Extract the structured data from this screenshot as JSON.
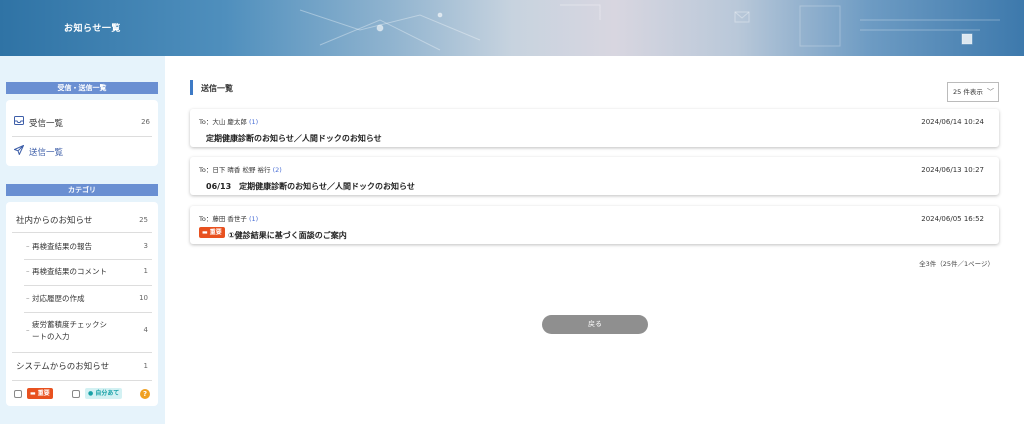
{
  "header": {
    "title": "お知らせ一覧"
  },
  "sidebar": {
    "mailbox_heading": "受信・送信一覧",
    "inbox": {
      "label": "受信一覧",
      "count": "26"
    },
    "sent": {
      "label": "送信一覧"
    },
    "category_heading": "カテゴリ",
    "categories": [
      {
        "label": "社内からのお知らせ",
        "count": "25"
      },
      {
        "label": "システムからのお知らせ",
        "count": "1"
      }
    ],
    "subcategories": [
      {
        "label": "再検査結果の報告",
        "count": "3"
      },
      {
        "label": "再検査結果のコメント",
        "count": "1"
      },
      {
        "label": "対応履歴の作成",
        "count": "10"
      },
      {
        "label_line1": "疲労蓄積度チェックシ",
        "label_line2": "ートの入力",
        "count": "4"
      }
    ],
    "filters": {
      "important_label": "重要",
      "self_label": "自分あて",
      "help": "?"
    },
    "colors": {
      "accent": "#6a8fd2",
      "important": "#e8511f",
      "self": "#17a1a6"
    }
  },
  "main": {
    "title": "送信一覧",
    "per_page": "25 件表示",
    "messages": [
      {
        "to_prefix": "To：",
        "to_names": "大山 慶太郎",
        "to_count": "(1)",
        "subject": "定期健康診断のお知らせ／人間ドックのお知らせ",
        "date": "2024/06/14 10:24"
      },
      {
        "to_prefix": "To：",
        "to_names": "日下 晴香 松野 裕行",
        "to_count": "(2)",
        "subject": "06/13　定期健康診断のお知らせ／人間ドックのお知らせ",
        "date": "2024/06/13 10:27"
      },
      {
        "to_prefix": "To：",
        "to_names": "藤田 香世子",
        "to_count": "(1)",
        "subject": "①健診結果に基づく面談のご案内",
        "badge": "重要",
        "date": "2024/06/05 16:52"
      }
    ],
    "summary": "全3件（25件／1ページ）",
    "back_label": "戻る"
  }
}
